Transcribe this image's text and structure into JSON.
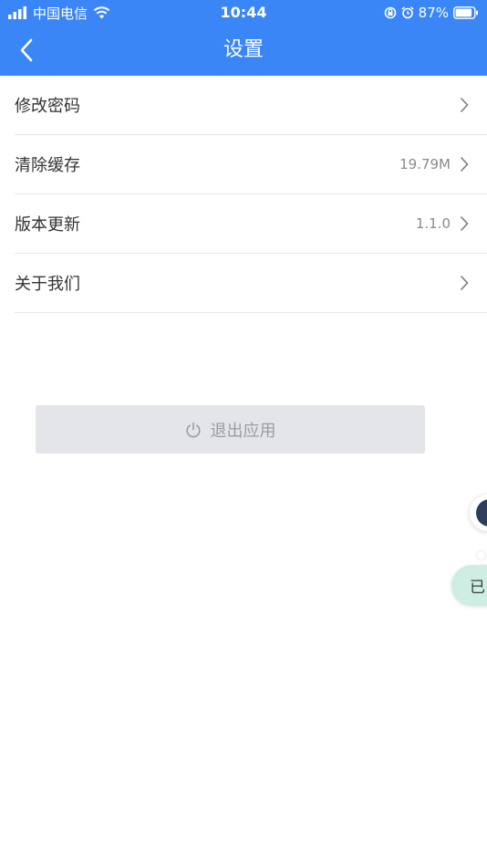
{
  "status_bar": {
    "carrier": "中国电信",
    "time": "10:44",
    "battery": "87%"
  },
  "header": {
    "title": "设置",
    "back_icon": "chevron-left-icon"
  },
  "settings": {
    "items": [
      {
        "label": "修改密码",
        "value": ""
      },
      {
        "label": "清除缓存",
        "value": "19.79M"
      },
      {
        "label": "版本更新",
        "value": "1.1.0"
      },
      {
        "label": "关于我们",
        "value": ""
      }
    ]
  },
  "logout": {
    "label": "退出应用",
    "icon": "power-icon"
  },
  "floating": {
    "badge_text": "已"
  },
  "colors": {
    "header_bg": "#3b86f7",
    "button_bg": "#e4e5e8",
    "badge_bg": "#cfeee3"
  }
}
